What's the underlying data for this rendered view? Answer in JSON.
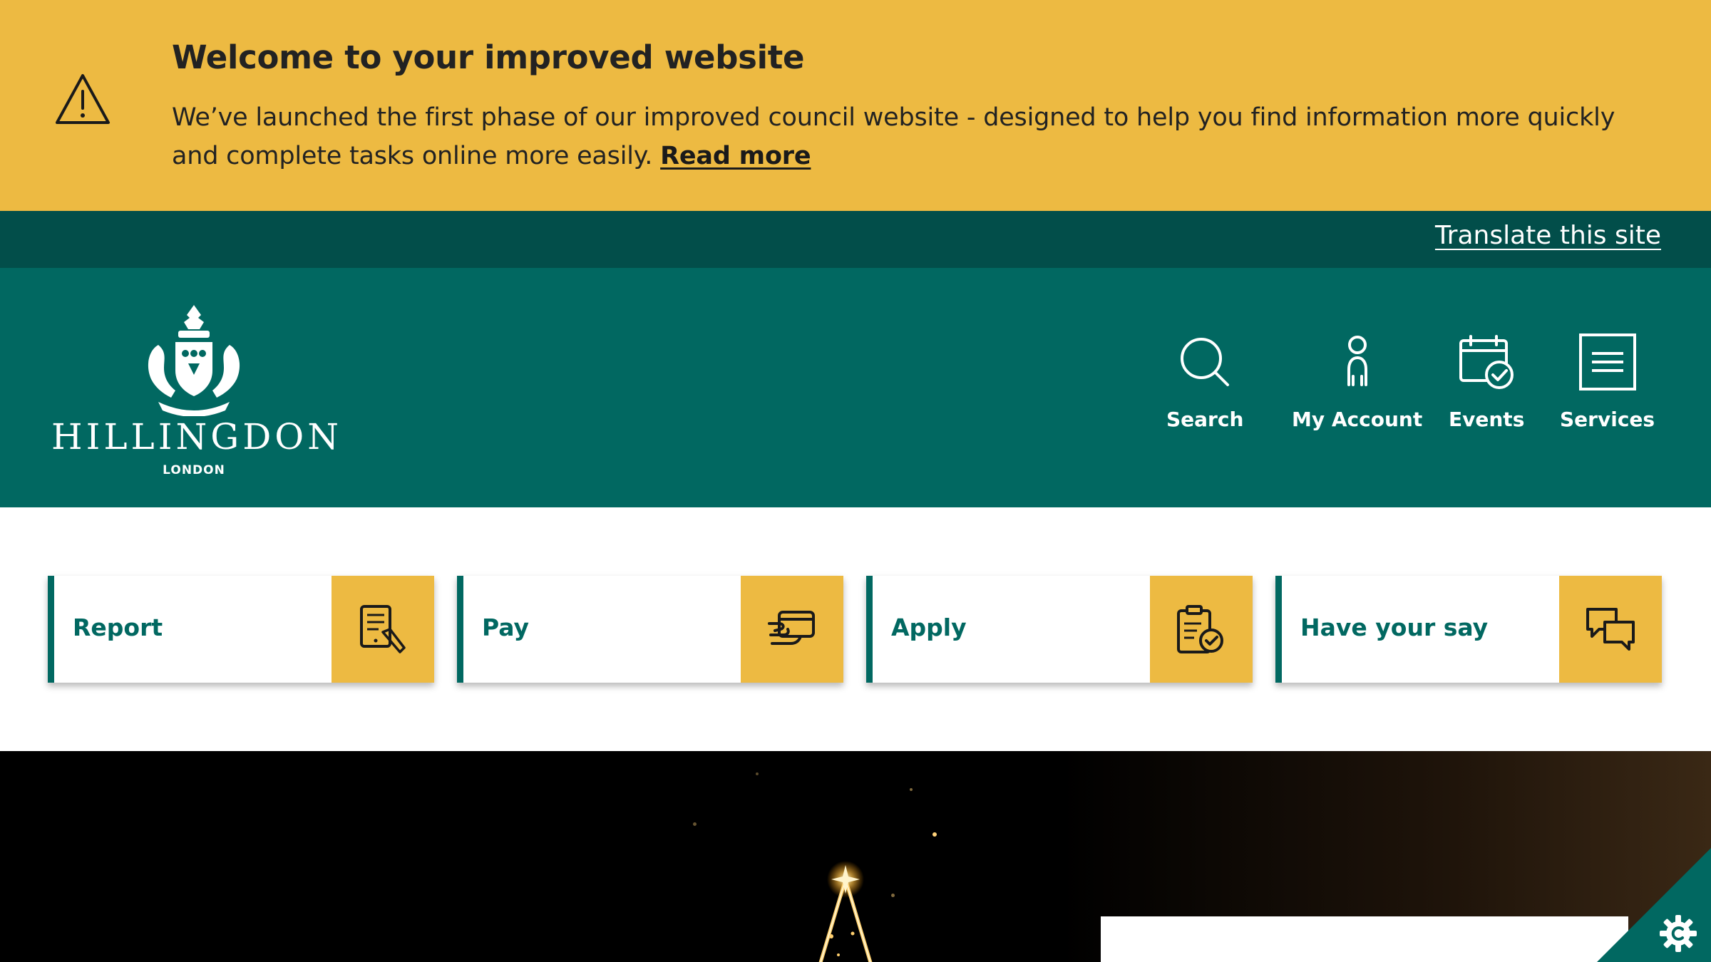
{
  "alert": {
    "icon": "warning-triangle-icon",
    "title": "Welcome to your improved website",
    "message": "We’ve launched the first phase of our improved council website - designed to help you find information more quickly and complete tasks online more easily.",
    "link_label": "Read more"
  },
  "utility": {
    "translate_label": "Translate this site"
  },
  "header": {
    "logo_name": "HILLINGDON",
    "logo_sub": "LONDON",
    "nav": [
      {
        "label": "Search",
        "icon": "search-icon"
      },
      {
        "label": "My Account",
        "icon": "account-icon"
      },
      {
        "label": "Events",
        "icon": "calendar-check-icon"
      },
      {
        "label": "Services",
        "icon": "menu-icon"
      }
    ]
  },
  "quick_links": [
    {
      "label": "Report",
      "icon": "report-document-icon"
    },
    {
      "label": "Pay",
      "icon": "card-payment-icon"
    },
    {
      "label": "Apply",
      "icon": "clipboard-check-icon"
    },
    {
      "label": "Have your say",
      "icon": "chat-bubbles-icon"
    }
  ],
  "cookie_button": {
    "icon": "cookie-settings-icon"
  },
  "colors": {
    "accent_yellow": "#edba42",
    "brand_teal": "#016861",
    "dark_teal": "#024e4a"
  }
}
